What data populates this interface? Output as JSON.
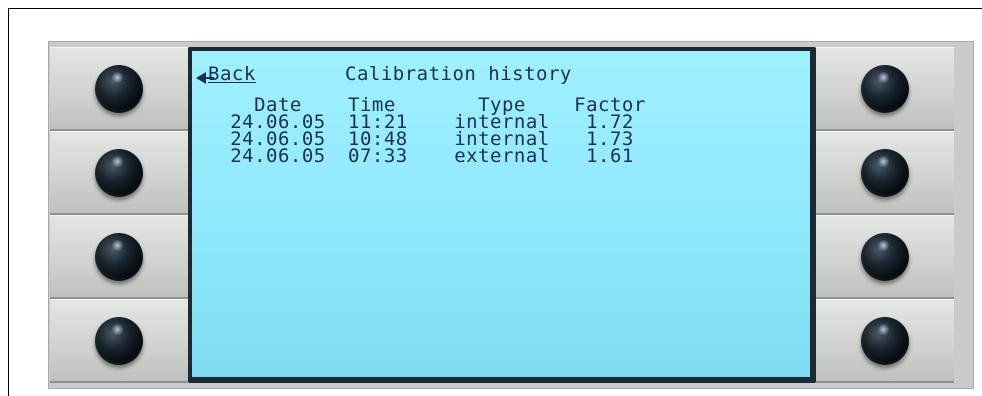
{
  "screen": {
    "back_label": "Back",
    "title": "Calibration history"
  },
  "table": {
    "headers": {
      "date": "Date",
      "time": "Time",
      "type": "Type",
      "factor": "Factor"
    },
    "rows": [
      {
        "date": "24.06.05",
        "time": "11:21",
        "type": "internal",
        "factor": "1.72"
      },
      {
        "date": "24.06.05",
        "time": "10:48",
        "type": "internal",
        "factor": "1.73"
      },
      {
        "date": "24.06.05",
        "time": "07:33",
        "type": "external",
        "factor": "1.61"
      }
    ]
  },
  "colors": {
    "lcd_background": "#8fe8fb",
    "lcd_text": "#1a2e5a",
    "bezel": "#1d2a33",
    "panel": "#c9cbc8",
    "knob": "#0b1218"
  },
  "icons": {
    "back": "back-arrow-icon",
    "softkey": "softkey-knob"
  }
}
